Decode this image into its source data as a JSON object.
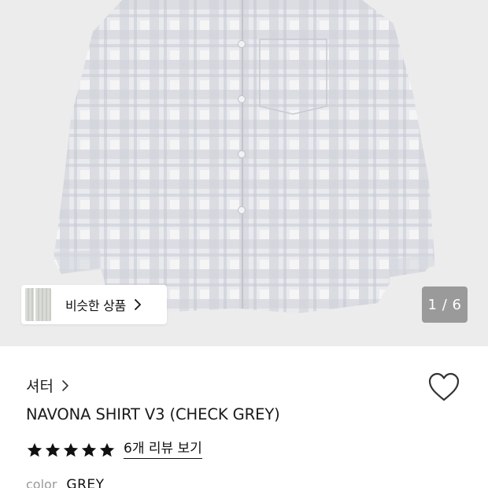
{
  "gallery": {
    "similar_label": "비슷한 상품",
    "counter": "1 / 6"
  },
  "product": {
    "brand": "셔터",
    "title": "NAVONA SHIRT V3 (CHECK GREY)",
    "rating_stars": 5,
    "review_link": "6개 리뷰 보기",
    "color_label": "color",
    "color_value": "GREY"
  },
  "colors": {
    "gallery_bg": "#ececec",
    "counter_bg": "#9a9a9a",
    "star": "#111111"
  },
  "icons": [
    "chevron-right-icon",
    "heart-icon",
    "star-icon"
  ]
}
